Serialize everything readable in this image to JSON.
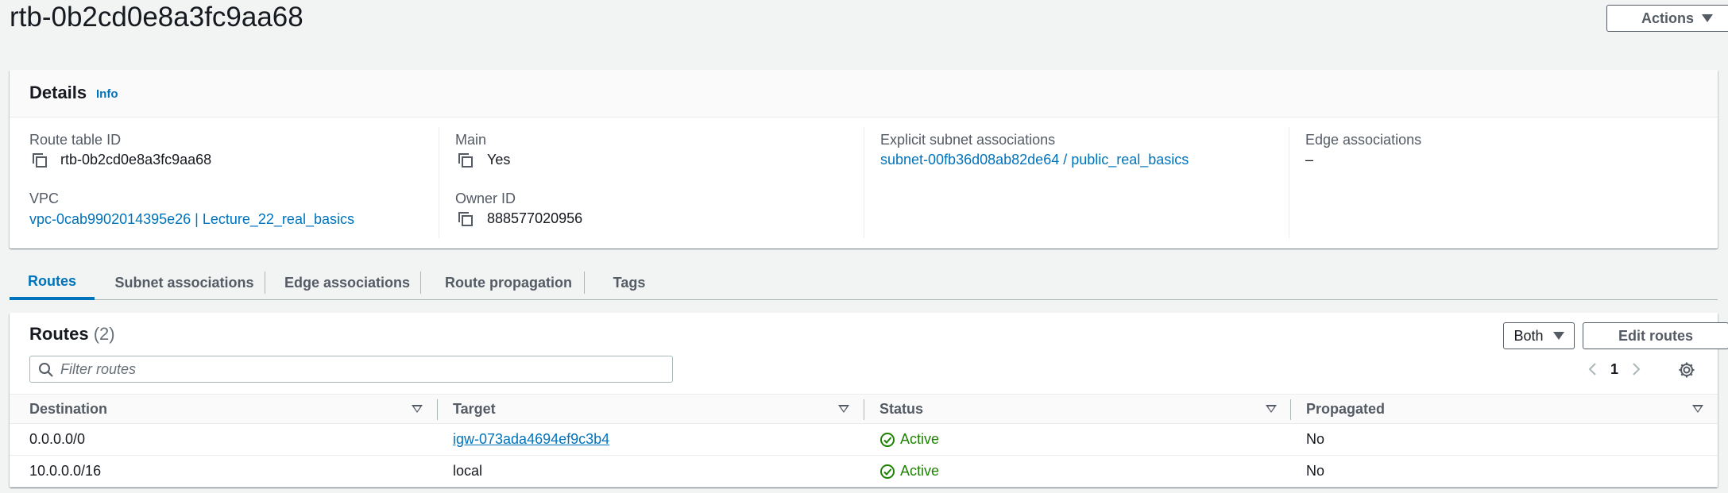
{
  "header": {
    "title": "rtb-0b2cd0e8a3fc9aa68",
    "actions_label": "Actions"
  },
  "details": {
    "title": "Details",
    "info": "Info",
    "route_table_id": {
      "label": "Route table ID",
      "value": "rtb-0b2cd0e8a3fc9aa68"
    },
    "vpc": {
      "label": "VPC",
      "value": "vpc-0cab9902014395e26 | Lecture_22_real_basics"
    },
    "main": {
      "label": "Main",
      "value": "Yes"
    },
    "owner_id": {
      "label": "Owner ID",
      "value": "888577020956"
    },
    "explicit_subnet": {
      "label": "Explicit subnet associations",
      "value": "subnet-00fb36d08ab82de64 / public_real_basics"
    },
    "edge": {
      "label": "Edge associations",
      "value": "–"
    }
  },
  "tabs": [
    {
      "label": "Routes",
      "active": true
    },
    {
      "label": "Subnet associations",
      "active": false
    },
    {
      "label": "Edge associations",
      "active": false
    },
    {
      "label": "Route propagation",
      "active": false
    },
    {
      "label": "Tags",
      "active": false
    }
  ],
  "routes": {
    "title": "Routes",
    "count": "(2)",
    "both_label": "Both",
    "edit_label": "Edit routes",
    "filter_placeholder": "Filter routes",
    "page": "1",
    "columns": [
      "Destination",
      "Target",
      "Status",
      "Propagated"
    ],
    "rows": [
      {
        "destination": "0.0.0.0/0",
        "target": "igw-073ada4694ef9c3b4",
        "target_is_link": true,
        "status": "Active",
        "propagated": "No"
      },
      {
        "destination": "10.0.0.0/16",
        "target": "local",
        "target_is_link": false,
        "status": "Active",
        "propagated": "No"
      }
    ]
  },
  "colors": {
    "link": "#0073bb",
    "success": "#1d8102",
    "text": "#16191f",
    "muted": "#545b64",
    "background": "#f2f3f3"
  }
}
